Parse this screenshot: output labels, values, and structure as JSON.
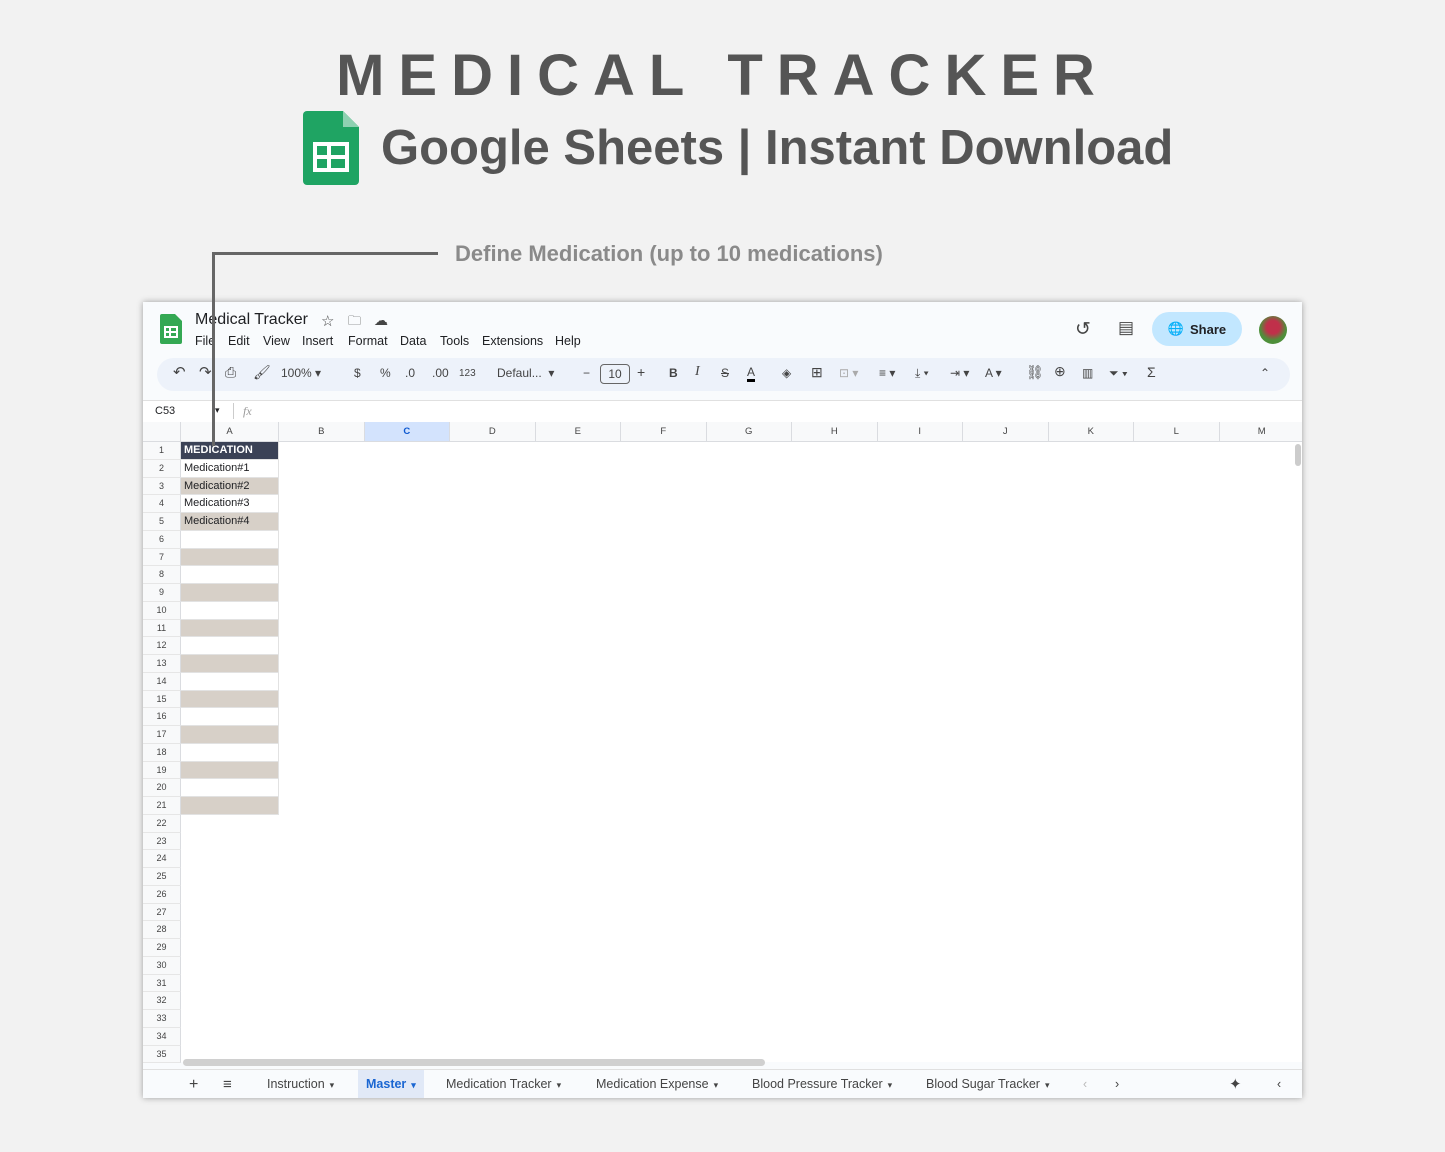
{
  "banner": {
    "title": "MEDICAL TRACKER",
    "subtitle": "Google Sheets | Instant Download",
    "annotation": "Define Medication (up to 10 medications)"
  },
  "window": {
    "doc_title": "Medical Tracker",
    "menu": [
      "File",
      "Edit",
      "View",
      "Insert",
      "Format",
      "Data",
      "Tools",
      "Extensions",
      "Help"
    ],
    "share_label": "Share"
  },
  "toolbar": {
    "zoom": "100%",
    "currency": "$",
    "percent": "%",
    "dec_dec": ".0",
    "inc_dec": ".00",
    "format_123": "123",
    "font": "Defaul...",
    "font_size": "10"
  },
  "formula_bar": {
    "cell_ref": "C53",
    "fx": "fx"
  },
  "columns": [
    "A",
    "B",
    "C",
    "D",
    "E",
    "F",
    "G",
    "H",
    "I",
    "J",
    "K",
    "L",
    "M"
  ],
  "selected_column": "C",
  "column_a": [
    "MEDICATION",
    "Medication#1",
    "Medication#2",
    "Medication#3",
    "Medication#4"
  ],
  "row_count": 35,
  "shaded_rows_to": 21,
  "colors": {
    "header_fill": "#3b4256",
    "shade_fill": "#d7d0c8",
    "accent": "#1a66d2",
    "share_bg": "#c2e7ff"
  },
  "tabs": {
    "items": [
      "Instruction",
      "Master",
      "Medication Tracker",
      "Medication Expense",
      "Blood Pressure Tracker",
      "Blood Sugar Tracker"
    ],
    "active": "Master"
  }
}
